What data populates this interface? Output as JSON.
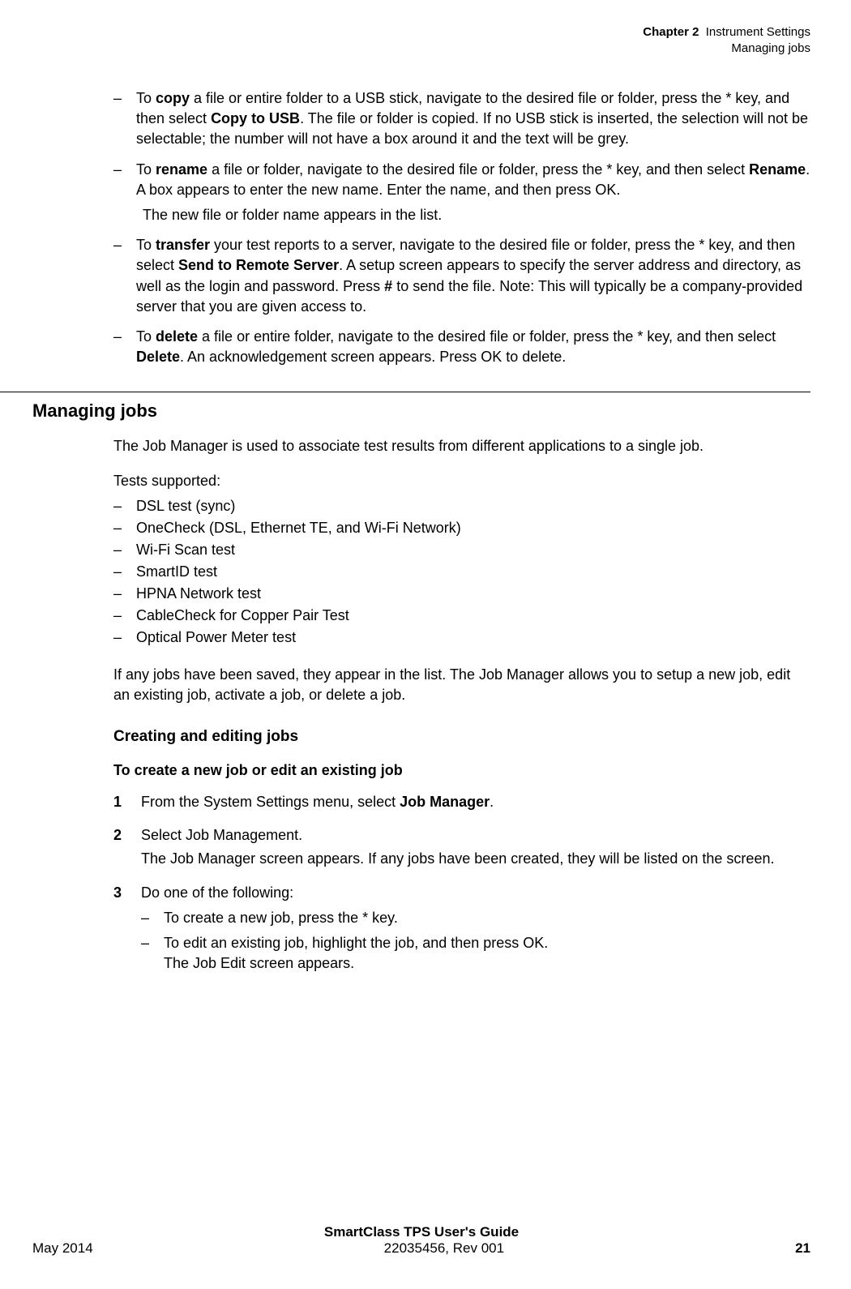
{
  "header": {
    "chapter_label": "Chapter 2",
    "chapter_title": "Instrument Settings",
    "section": "Managing jobs"
  },
  "file_ops": {
    "copy": {
      "pre": "To ",
      "bold1": "copy",
      "mid1": " a file or entire folder to a USB stick, navigate to the desired file or folder, press the * key, and then select ",
      "bold2": "Copy to USB",
      "post": ". The file or folder is copied. If no USB stick is inserted, the selection will not be selectable; the number will not have a box around it and the text will be grey."
    },
    "rename": {
      "pre": "To ",
      "bold1": "rename",
      "mid1": " a file or folder, navigate to the desired file or folder, press the * key, and then select ",
      "bold2": "Rename",
      "post": ". A box appears to enter the new name. Enter the name, and then press OK.",
      "note": "The new file or folder name appears in the list."
    },
    "transfer": {
      "pre": "To ",
      "bold1": "transfer",
      "mid1": " your test reports to a server, navigate to the desired file or folder, press the * key, and then select ",
      "bold2": "Send to Remote Server",
      "mid2": ". A setup screen appears to specify the server address and directory, as well as the login and password. Press ",
      "bold3": "#",
      "post": " to send the file. Note: This will typically be a company-provided server that you are given access to."
    },
    "delete": {
      "pre": "To ",
      "bold1": "delete",
      "mid1": " a file or entire folder, navigate to the desired file or folder, press the * key, and then select ",
      "bold2": "Delete",
      "post": ". An acknowledgement screen appears. Press OK to delete."
    }
  },
  "managing_jobs": {
    "heading": "Managing jobs",
    "intro": "The Job Manager is used to associate test results from different applications to a single job.",
    "tests_label": "Tests supported:",
    "tests": [
      "DSL test (sync)",
      "OneCheck (DSL, Ethernet TE, and Wi-Fi Network)",
      "Wi-Fi Scan test",
      "SmartID test",
      "HPNA Network test",
      "CableCheck for Copper Pair Test",
      "Optical Power Meter test"
    ],
    "outro": "If any jobs have been saved, they appear in the list. The Job Manager allows you to setup a new job, edit an existing job, activate a job, or delete a job."
  },
  "creating": {
    "heading": "Creating and editing jobs",
    "procedure_heading": "To create a new job or edit an existing job",
    "steps": {
      "s1": {
        "num": "1",
        "pre": "From the System Settings menu, select ",
        "bold": "Job Manager",
        "post": "."
      },
      "s2": {
        "num": "2",
        "text": "Select Job Management.",
        "note": "The Job Manager screen appears. If any jobs have been created, they will be listed on the screen."
      },
      "s3": {
        "num": "3",
        "text": "Do one of the following:",
        "sub1": "To create a new job, press the * key.",
        "sub2_line1": "To edit an existing job, highlight the job, and then press OK.",
        "sub2_line2": "The Job Edit screen appears."
      }
    }
  },
  "footer": {
    "title": "SmartClass TPS User's Guide",
    "docnum": "22035456, Rev 001",
    "date": "May 2014",
    "page": "21"
  }
}
